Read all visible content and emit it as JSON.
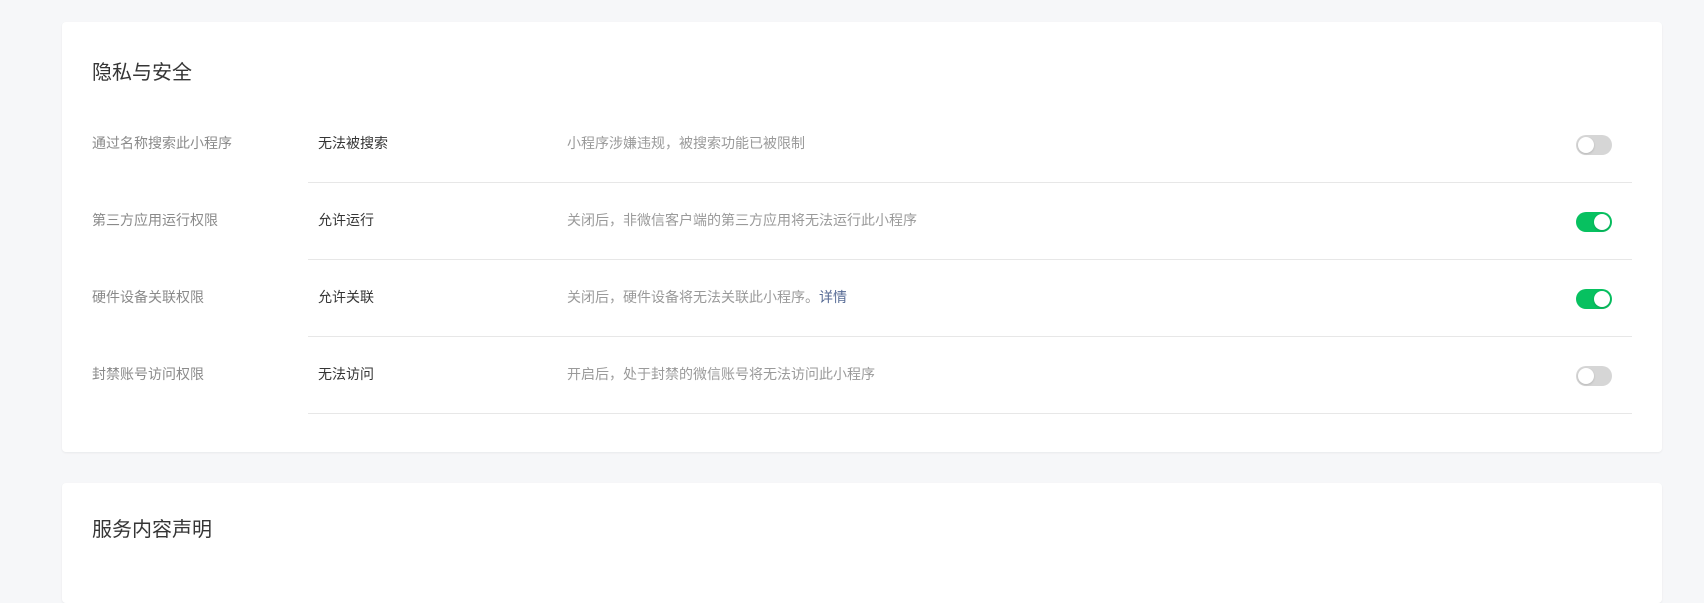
{
  "privacy": {
    "title": "隐私与安全",
    "rows": [
      {
        "label": "通过名称搜索此小程序",
        "status": "无法被搜索",
        "desc": "小程序涉嫌违规，被搜索功能已被限制",
        "link": "",
        "enabled": false
      },
      {
        "label": "第三方应用运行权限",
        "status": "允许运行",
        "desc": "关闭后，非微信客户端的第三方应用将无法运行此小程序",
        "link": "",
        "enabled": true
      },
      {
        "label": "硬件设备关联权限",
        "status": "允许关联",
        "desc": "关闭后，硬件设备将无法关联此小程序。",
        "link": "详情",
        "enabled": true
      },
      {
        "label": "封禁账号访问权限",
        "status": "无法访问",
        "desc": "开启后，处于封禁的微信账号将无法访问此小程序",
        "link": "",
        "enabled": false
      }
    ]
  },
  "service": {
    "title": "服务内容声明"
  },
  "colors": {
    "toggle_on": "#07c160",
    "toggle_off": "#d6d6d6",
    "link": "#576b95"
  }
}
